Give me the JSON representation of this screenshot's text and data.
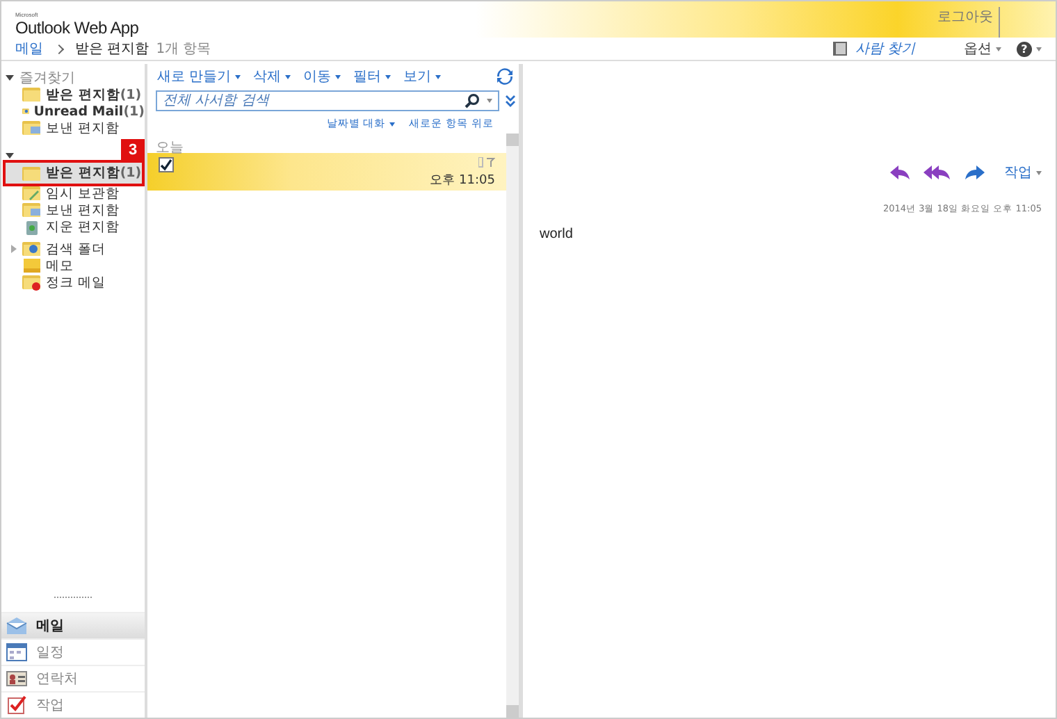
{
  "app": {
    "brand": "Microsoft",
    "logo": "Outlook Web App",
    "logout": "로그아웃"
  },
  "breadcrumb": {
    "root": "메일",
    "folder": "받은 편지함",
    "count": "1개 항목"
  },
  "top_links": {
    "find_people": "사람 찾기",
    "options": "옵션",
    "help": "?"
  },
  "favorites": {
    "title": "즐겨찾기",
    "expanded": true,
    "items": [
      {
        "label": "받은 편지함",
        "count": "(1)",
        "kind": "inbox",
        "unread": true
      },
      {
        "label": "Unread Mail",
        "count": "(1)",
        "kind": "search",
        "unread": true
      },
      {
        "label": "보낸 편지함",
        "kind": "sent",
        "unread": false
      }
    ]
  },
  "mailbox": {
    "expanded": true,
    "callout": "3",
    "items": [
      {
        "label": "받은 편지함",
        "count": "(1)",
        "kind": "inbox",
        "unread": true,
        "selected": true,
        "highlighted": true
      },
      {
        "label": "임시 보관함",
        "kind": "drafts",
        "unread": false,
        "selected": false,
        "highlighted": false
      },
      {
        "label": "보낸 편지함",
        "kind": "sent",
        "unread": false,
        "selected": false,
        "highlighted": false
      },
      {
        "label": "지운 편지함",
        "kind": "deleted",
        "unread": false,
        "selected": false,
        "highlighted": false
      },
      {
        "label": "검색 폴더",
        "kind": "search",
        "unread": false,
        "selected": false,
        "highlighted": false,
        "expanded": false
      },
      {
        "label": "메모",
        "kind": "notes",
        "unread": false,
        "selected": false,
        "highlighted": false
      },
      {
        "label": "정크 메일",
        "kind": "junk",
        "unread": false,
        "selected": false,
        "highlighted": false
      }
    ]
  },
  "toolbar": [
    "새로 만들기",
    "삭제",
    "이동",
    "필터",
    "보기"
  ],
  "search": {
    "placeholder": "전체 사서함 검색"
  },
  "list_options": {
    "sort": "날짜별 대화",
    "order": "새로운 항목 위로"
  },
  "groups": [
    {
      "title": "오늘",
      "messages": [
        {
          "checked": true,
          "selected": true,
          "time": "오후 11:05"
        }
      ]
    }
  ],
  "reading": {
    "date": "2014년 3월 18일 화요일 오후 11:05",
    "actions": "작업",
    "body": "world"
  },
  "modules": [
    {
      "label": "메일",
      "kind": "mail",
      "selected": true
    },
    {
      "label": "일정",
      "kind": "calendar",
      "selected": false
    },
    {
      "label": "연락처",
      "kind": "contacts",
      "selected": false
    },
    {
      "label": "작업",
      "kind": "tasks",
      "selected": false
    }
  ]
}
